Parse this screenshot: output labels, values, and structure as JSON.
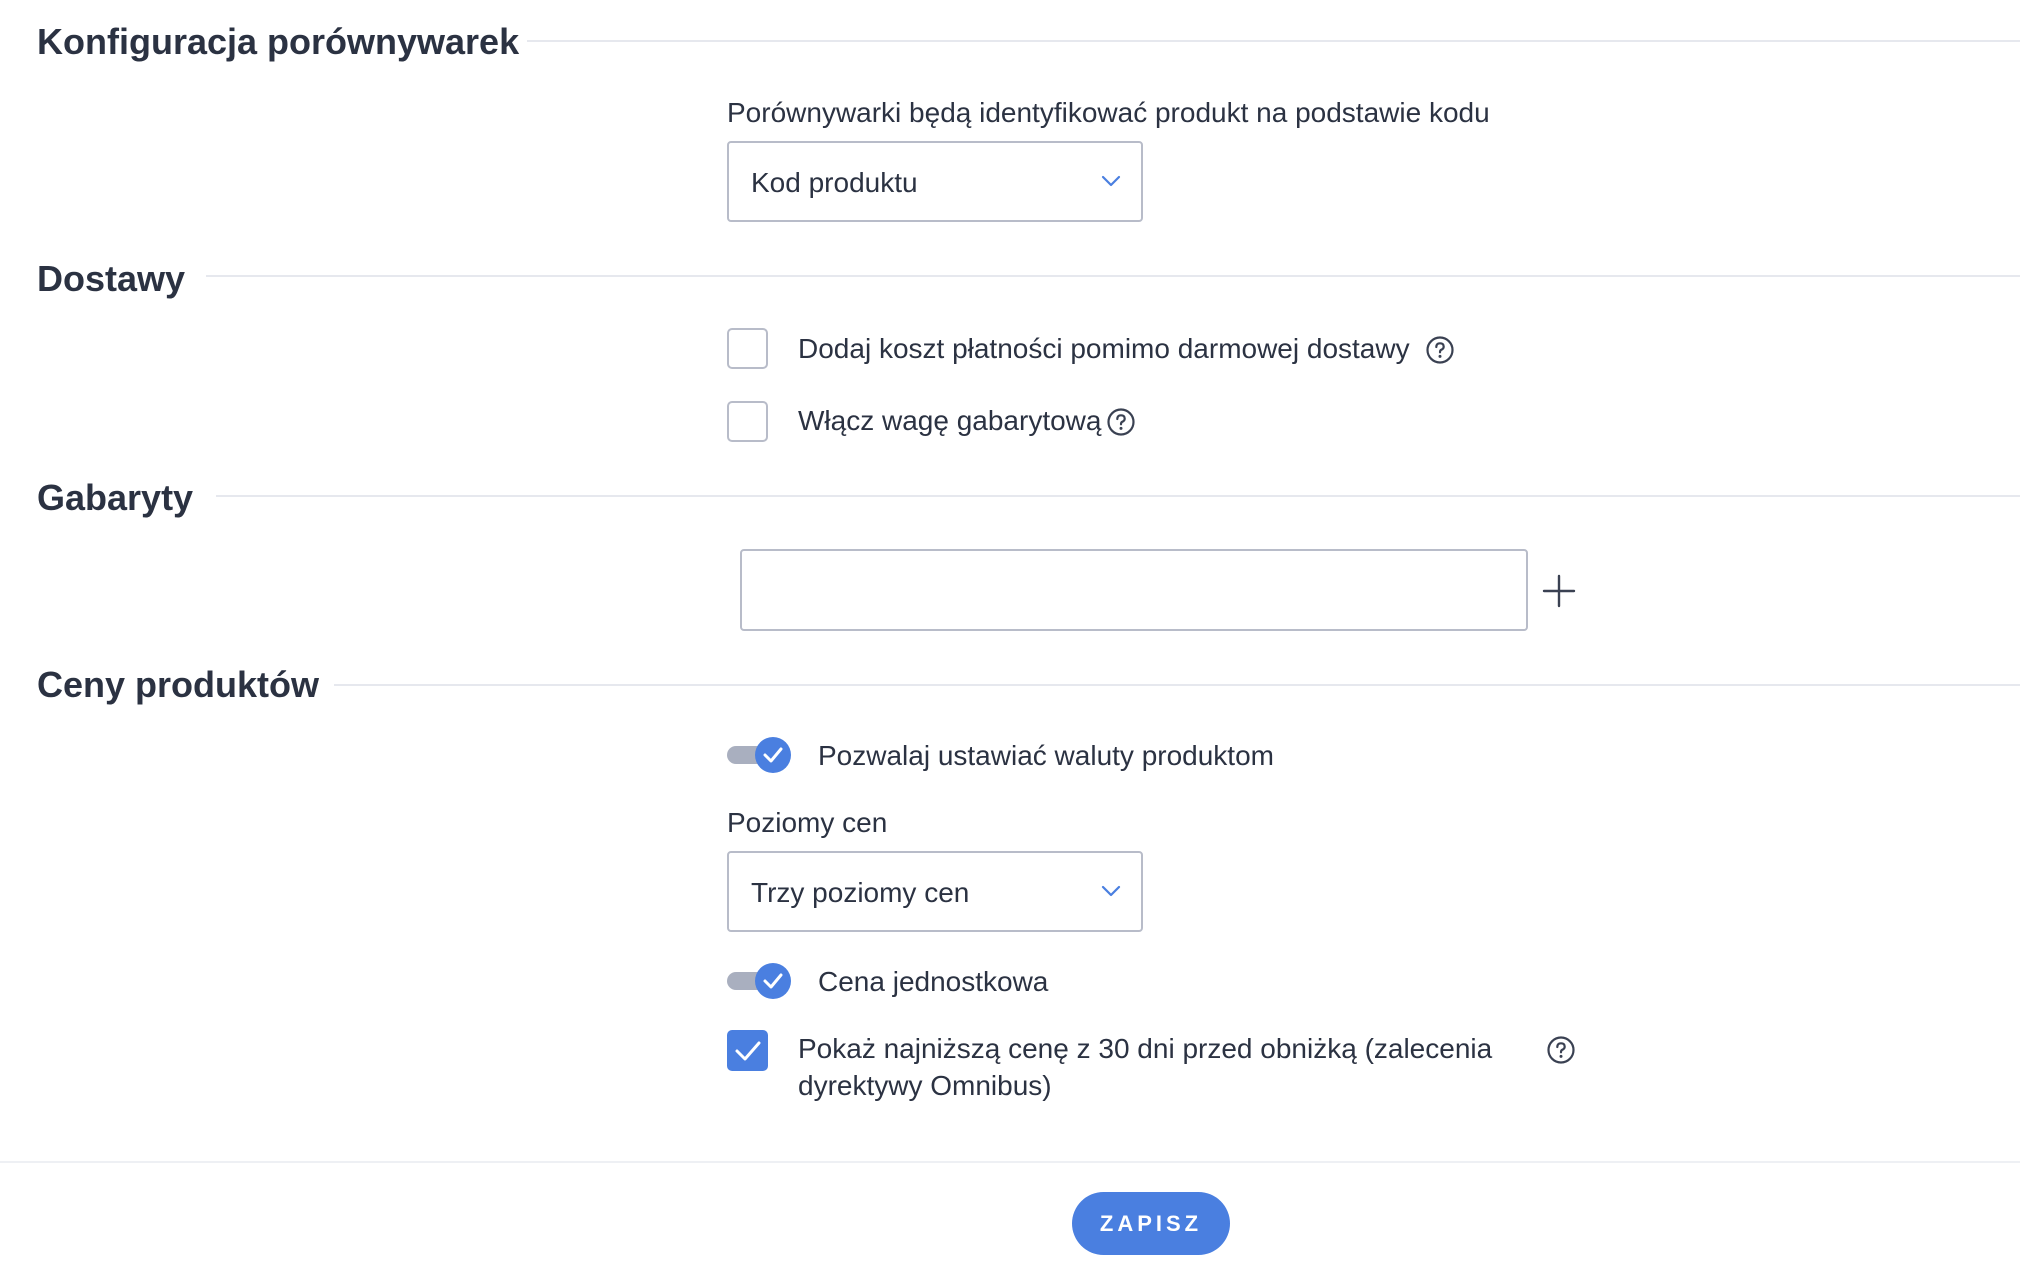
{
  "sections": {
    "comparators": {
      "title": "Konfiguracja porównywarek",
      "identify_label": "Porównywarki będą identyfikować produkt na podstawie kodu",
      "identify_select_value": "Kod produktu"
    },
    "deliveries": {
      "title": "Dostawy",
      "add_payment_cost_label": "Dodaj koszt płatności pomimo darmowej dostawy",
      "add_payment_cost_checked": false,
      "dimensional_weight_label": "Włącz wagę gabarytową",
      "dimensional_weight_checked": false
    },
    "dimensions": {
      "title": "Gabaryty",
      "input_value": ""
    },
    "prices": {
      "title": "Ceny produktów",
      "currency_toggle_label": "Pozwalaj ustawiać waluty produktom",
      "currency_toggle_on": true,
      "price_levels_label": "Poziomy cen",
      "price_levels_value": "Trzy poziomy cen",
      "unit_price_label": "Cena jednostkowa",
      "unit_price_on": true,
      "omnibus_label_line1": "Pokaż najniższą cenę z 30 dni przed obniżką (zalecenia",
      "omnibus_label_line2": "dyrektywy Omnibus)",
      "omnibus_checked": true
    }
  },
  "footer": {
    "save_label": "ZAPISZ"
  },
  "icons": {
    "help": "question-circle-icon",
    "chevron": "chevron-down-icon",
    "plus": "plus-icon",
    "check": "check-icon"
  },
  "colors": {
    "accent": "#4a7fe0",
    "text": "#2b3242",
    "border": "#b8bcc9",
    "divider": "#e6e8ee",
    "toggle_track": "#a9afbf"
  }
}
